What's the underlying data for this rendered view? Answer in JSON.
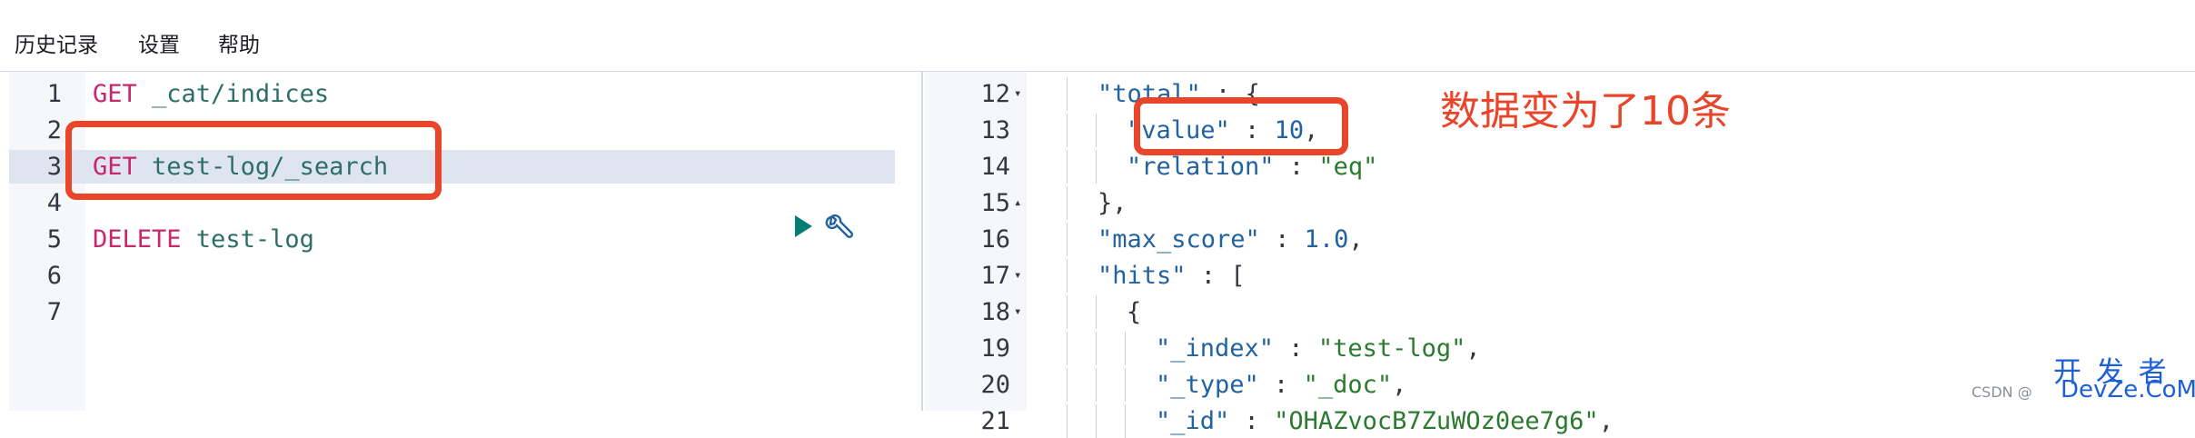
{
  "menu": [
    "历史记录",
    "设置",
    "帮助"
  ],
  "editor": {
    "lines": [
      {
        "num": "1",
        "method": "GET",
        "path": " _cat/indices"
      },
      {
        "num": "2",
        "method": "",
        "path": ""
      },
      {
        "num": "3",
        "method": "GET",
        "path": " test-log/_search"
      },
      {
        "num": "4",
        "method": "",
        "path": ""
      },
      {
        "num": "5",
        "method": "DELETE",
        "path": " test-log"
      },
      {
        "num": "6",
        "method": "",
        "path": ""
      },
      {
        "num": "7",
        "method": "",
        "path": ""
      }
    ],
    "active_line": 3
  },
  "output": {
    "lines": [
      {
        "num": "12",
        "fold": "▾",
        "code": "\"total\" : {"
      },
      {
        "num": "13",
        "fold": "",
        "code": "\"value\" : 10,"
      },
      {
        "num": "14",
        "fold": "",
        "code": "\"relation\" : \"eq\""
      },
      {
        "num": "15",
        "fold": "▴",
        "code": "},"
      },
      {
        "num": "16",
        "fold": "",
        "code": "\"max_score\" : 1.0,"
      },
      {
        "num": "17",
        "fold": "▾",
        "code": "\"hits\" : ["
      },
      {
        "num": "18",
        "fold": "▾",
        "code": "{"
      },
      {
        "num": "19",
        "fold": "",
        "code": "\"_index\" : \"test-log\","
      },
      {
        "num": "20",
        "fold": "",
        "code": "\"_type\" : \"_doc\","
      },
      {
        "num": "21",
        "fold": "",
        "code": "\"_id\" : \"OHAZvocB7ZuWOz0ee7g6\","
      }
    ]
  },
  "annotation": {
    "text": "数据变为了10条",
    "color": "#e8452b"
  },
  "watermark": {
    "main": "开 发 者",
    "sub": "DevZe.CoM",
    "csdn": "CSDN @"
  },
  "icons": [
    "play-icon",
    "wrench-icon"
  ]
}
